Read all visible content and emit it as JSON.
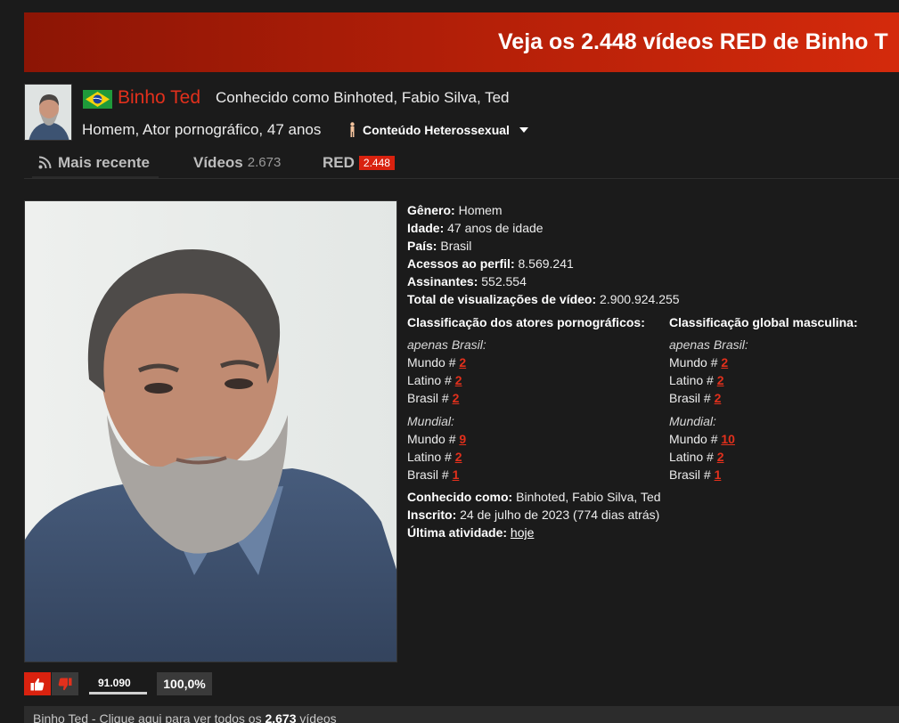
{
  "banner": {
    "text": "Veja os 2.448 vídeos RED de Binho T"
  },
  "profile": {
    "name": "Binho Ted",
    "aka": "Conhecido como Binhoted, Fabio Silva, Ted",
    "description": "Homem, Ator pornográfico, 47 anos",
    "orientation": "Conteúdo Heterossexual",
    "flag_icon": "brazil-flag-icon"
  },
  "tabs": [
    {
      "label": "Mais recente",
      "icon": "rss-icon"
    },
    {
      "label": "Vídeos",
      "count": "2.673"
    },
    {
      "label": "RED",
      "count": "2.448"
    }
  ],
  "details": {
    "genero": {
      "label": "Gênero:",
      "value": "Homem"
    },
    "idade": {
      "label": "Idade:",
      "value": "47 anos de idade"
    },
    "pais": {
      "label": "País:",
      "value": "Brasil"
    },
    "acessos": {
      "label": "Acessos ao perfil:",
      "value": "8.569.241"
    },
    "assinantes": {
      "label": "Assinantes:",
      "value": "552.554"
    },
    "visualizacoes": {
      "label": "Total de visualizações de vídeo:",
      "value": "2.900.924.255"
    }
  },
  "rankings": {
    "left": {
      "title": "Classificação dos atores pornográficos:",
      "brasil_only": {
        "label": "apenas Brasil:",
        "mundo": "2",
        "latino": "2",
        "brasil": "2"
      },
      "mundial": {
        "label": "Mundial:",
        "mundo": "9",
        "latino": "2",
        "brasil": "1"
      }
    },
    "right": {
      "title": "Classificação global masculina:",
      "brasil_only": {
        "label": "apenas Brasil:",
        "mundo": "2",
        "latino": "2",
        "brasil": "2"
      },
      "mundial": {
        "label": "Mundial:",
        "mundo": "10",
        "latino": "2",
        "brasil": "1"
      }
    },
    "labels": {
      "mundo": "Mundo #",
      "latino": "Latino #",
      "brasil": "Brasil #"
    }
  },
  "extra": {
    "conhecido": {
      "label": "Conhecido como:",
      "value": "Binhoted, Fabio Silva, Ted"
    },
    "inscrito": {
      "label": "Inscrito:",
      "value": "24 de julho de 2023 (774 dias atrás)"
    },
    "atividade": {
      "label": "Última atividade:",
      "value": "hoje"
    }
  },
  "rating": {
    "votes": "91.090",
    "percent": "100,0%",
    "fraction": 1.0,
    "like_icon": "thumbs-up-icon",
    "dislike_icon": "thumbs-down-icon"
  },
  "footer": {
    "name": "Binho Ted",
    "text_before": " - Clique aqui para ver todos os ",
    "count": "2.673",
    "text_after": " vídeos"
  },
  "colors": {
    "accent": "#e2301c",
    "banner": "#b31f08",
    "background": "#1b1b1b"
  }
}
